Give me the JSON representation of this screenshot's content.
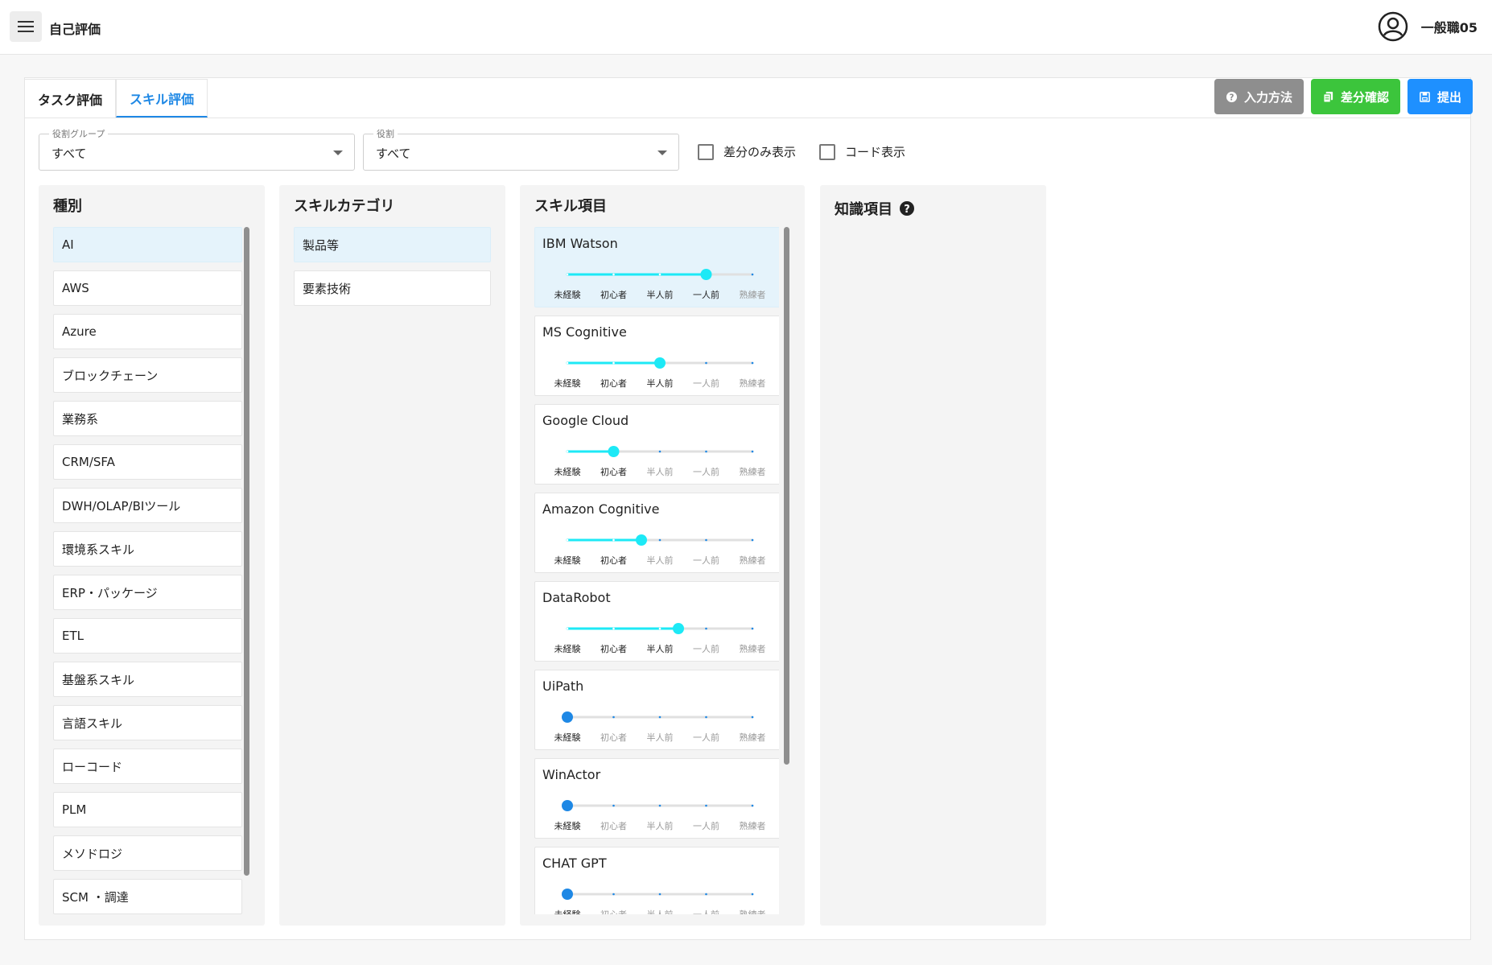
{
  "header": {
    "title": "自己評価",
    "user_name": "一般職05"
  },
  "tabs": [
    {
      "label": "タスク評価",
      "active": false
    },
    {
      "label": "スキル評価",
      "active": true
    }
  ],
  "actions": {
    "input_method": "入力方法",
    "diff_check": "差分確認",
    "submit": "提出"
  },
  "filters": {
    "role_group": {
      "label": "役割グループ",
      "value": "すべて"
    },
    "role": {
      "label": "役割",
      "value": "すべて"
    },
    "diff_only_label": "差分のみ表示",
    "code_display_label": "コード表示"
  },
  "panels": {
    "types_title": "種別",
    "category_title": "スキルカテゴリ",
    "skill_title": "スキル項目",
    "knowledge_title": "知識項目"
  },
  "types": [
    "AI",
    "AWS",
    "Azure",
    "ブロックチェーン",
    "業務系",
    "CRM/SFA",
    "DWH/OLAP/BIツール",
    "環境系スキル",
    "ERP・パッケージ",
    "ETL",
    "基盤系スキル",
    "言語スキル",
    "ローコード",
    "PLM",
    "メソドロジ",
    "SCM ・調達"
  ],
  "categories": [
    "製品等",
    "要素技術"
  ],
  "levels": [
    "未経験",
    "初心者",
    "半人前",
    "一人前",
    "熟練者"
  ],
  "skills": [
    {
      "name": "IBM Watson",
      "value": 3,
      "changed": true
    },
    {
      "name": "MS Cognitive",
      "value": 2,
      "changed": true
    },
    {
      "name": "Google Cloud",
      "value": 1,
      "changed": true
    },
    {
      "name": "Amazon Cognitive",
      "value": 1.6,
      "changed": true
    },
    {
      "name": "DataRobot",
      "value": 2.4,
      "changed": true
    },
    {
      "name": "UiPath",
      "value": 0,
      "changed": false
    },
    {
      "name": "WinActor",
      "value": 0,
      "changed": false
    },
    {
      "name": "CHAT GPT",
      "value": 0,
      "changed": false
    }
  ],
  "colors": {
    "changed_track": "#1de9f6",
    "unchanged_thumb": "#1e88e5",
    "track": "#e0e0e0"
  }
}
